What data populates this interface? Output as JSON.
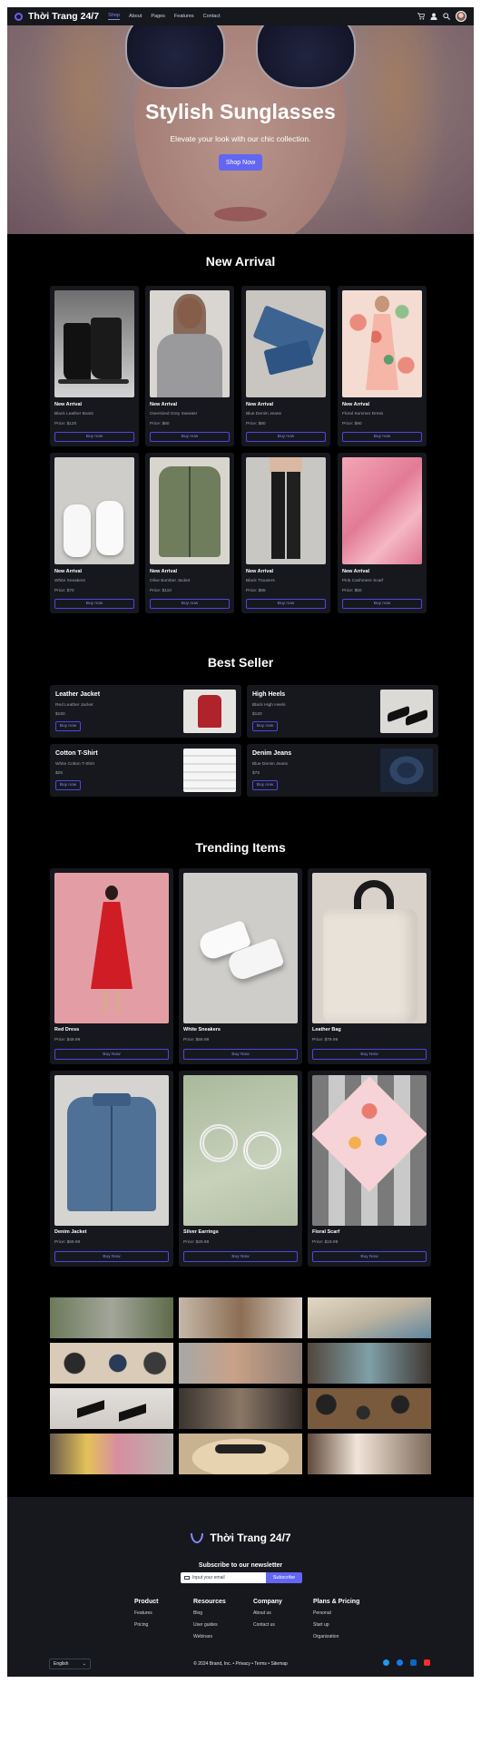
{
  "nav": {
    "brand": "Thời Trang 24/7",
    "links": [
      "Shop",
      "About",
      "Pages",
      "Features",
      "Contact"
    ],
    "icons": [
      "cart-icon",
      "user-icon",
      "search-icon",
      "avatar"
    ]
  },
  "hero": {
    "title": "Stylish Sunglasses",
    "subtitle": "Elevate your look with our chic collection.",
    "cta": "Shop Now"
  },
  "new_arrival": {
    "title": "New Arrival",
    "items": [
      {
        "tag": "New Arrival",
        "name": "Black Leather Boots",
        "price": "Price: $120",
        "button": "Buy now"
      },
      {
        "tag": "New Arrival",
        "name": "Oversized Grey Sweater",
        "price": "Price: $60",
        "button": "Buy now"
      },
      {
        "tag": "New Arrival",
        "name": "Blue Denim Jeans",
        "price": "Price: $80",
        "button": "Buy now"
      },
      {
        "tag": "New Arrival",
        "name": "Floral Summer Dress",
        "price": "Price: $90",
        "button": "Buy now"
      },
      {
        "tag": "New Arrival",
        "name": "White Sneakers",
        "price": "Price: $70",
        "button": "Buy now"
      },
      {
        "tag": "New Arrival",
        "name": "Olive Bomber Jacket",
        "price": "Price: $110",
        "button": "Buy now"
      },
      {
        "tag": "New Arrival",
        "name": "Black Trousers",
        "price": "Price: $65",
        "button": "Buy now"
      },
      {
        "tag": "New Arrival",
        "name": "Pink Cashmere Scarf",
        "price": "Price: $50",
        "button": "Buy now"
      }
    ]
  },
  "best_seller": {
    "title": "Best Seller",
    "items": [
      {
        "name": "Leather Jacket",
        "desc": "Red Leather Jacket",
        "price": "$150",
        "button": "Buy now"
      },
      {
        "name": "High Heels",
        "desc": "Black High Heels",
        "price": "$120",
        "button": "Buy now"
      },
      {
        "name": "Cotton T-Shirt",
        "desc": "White Cotton T-Shirt",
        "price": "$25",
        "button": "Buy now"
      },
      {
        "name": "Denim Jeans",
        "desc": "Blue Denim Jeans",
        "price": "$75",
        "button": "Buy now"
      }
    ]
  },
  "trending": {
    "title": "Trending Items",
    "items": [
      {
        "name": "Red Dress",
        "price": "Price: $49.99",
        "button": "Buy Now"
      },
      {
        "name": "White Sneakers",
        "price": "Price: $59.99",
        "button": "Buy Now"
      },
      {
        "name": "Leather Bag",
        "price": "Price: $79.99",
        "button": "Buy Now"
      },
      {
        "name": "Denim Jacket",
        "price": "Price: $69.99",
        "button": "Buy Now"
      },
      {
        "name": "Silver Earrings",
        "price": "Price: $29.99",
        "button": "Buy Now"
      },
      {
        "name": "Floral Scarf",
        "price": "Price: $19.99",
        "button": "Buy Now"
      }
    ]
  },
  "footer": {
    "brand": "Thời Trang 24/7",
    "newsletter_title": "Subscribe to our newsletter",
    "email_placeholder": "Input your email",
    "subscribe": "Subscribe",
    "columns": [
      {
        "heading": "Product",
        "items": [
          "Features",
          "Pricing"
        ]
      },
      {
        "heading": "Resources",
        "items": [
          "Blog",
          "User guides",
          "Webinars"
        ]
      },
      {
        "heading": "Company",
        "items": [
          "About us",
          "Contact us"
        ]
      },
      {
        "heading": "Plans & Pricing",
        "items": [
          "Personal",
          "Start up",
          "Organization"
        ]
      }
    ],
    "language": "English",
    "legal": "© 2024 Brand, Inc. • Privacy • Terms • Sitemap",
    "social": [
      "twitter-icon",
      "facebook-icon",
      "linkedin-icon",
      "youtube-icon"
    ]
  },
  "colors": {
    "accent": "#6366f1",
    "background": "#000000",
    "card": "#16181d"
  }
}
